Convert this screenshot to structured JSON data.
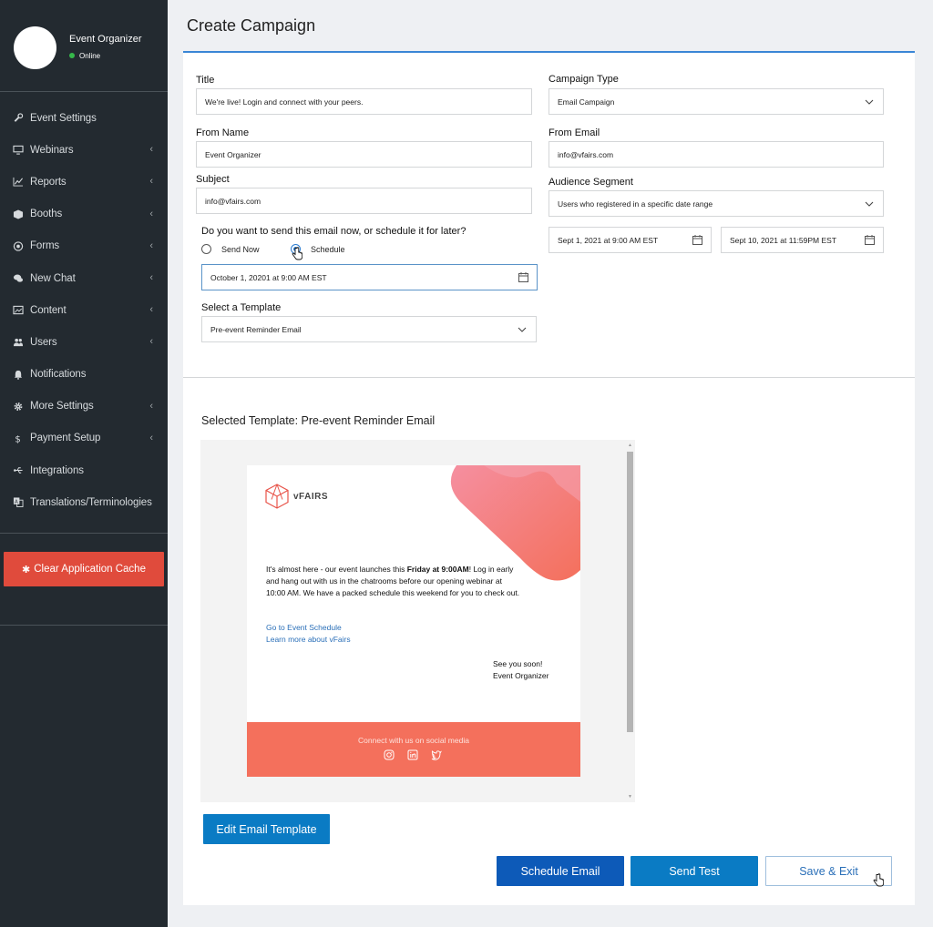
{
  "sidebar": {
    "profile": {
      "name": "Event Organizer",
      "status": "Online"
    },
    "items": [
      {
        "label": "Event Settings",
        "icon": "wrench-icon",
        "chevron": false
      },
      {
        "label": "Webinars",
        "icon": "monitor-icon",
        "chevron": true
      },
      {
        "label": "Reports",
        "icon": "chart-icon",
        "chevron": true
      },
      {
        "label": "Booths",
        "icon": "cube-icon",
        "chevron": true
      },
      {
        "label": "Forms",
        "icon": "target-icon",
        "chevron": true
      },
      {
        "label": "New Chat",
        "icon": "chat-icon",
        "chevron": true
      },
      {
        "label": "Content",
        "icon": "image-icon",
        "chevron": true
      },
      {
        "label": "Users",
        "icon": "users-icon",
        "chevron": true
      },
      {
        "label": "Notifications",
        "icon": "bell-icon",
        "chevron": false
      },
      {
        "label": "More Settings",
        "icon": "gear-icon",
        "chevron": true
      },
      {
        "label": "Payment Setup",
        "icon": "dollar-icon",
        "chevron": true
      },
      {
        "label": "Integrations",
        "icon": "plug-icon",
        "chevron": false
      },
      {
        "label": "Translations/Terminologies",
        "icon": "translate-icon",
        "chevron": false
      }
    ],
    "chevron_glyph": "‹",
    "clear_cache_label": "Clear Application Cache"
  },
  "page": {
    "title": "Create Campaign"
  },
  "form": {
    "title_label": "Title",
    "title_value": "We're live! Login and connect with your peers.",
    "campaign_type_label": "Campaign Type",
    "campaign_type_value": "Email Campaign",
    "from_name_label": "From Name",
    "from_name_value": "Event Organizer",
    "from_email_label": "From Email",
    "from_email_value": "info@vfairs.com",
    "subject_label": "Subject",
    "subject_value": "info@vfairs.com",
    "audience_label": "Audience Segment",
    "audience_value": "Users who registered in a specific date range",
    "date_start": "Sept 1, 2021 at 9:00 AM EST",
    "date_end": "Sept 10, 2021 at 11:59PM EST",
    "send_question": "Do you want to send this email now, or schedule it for later?",
    "send_now_label": "Send Now",
    "schedule_label": "Schedule",
    "selected_option": "Schedule",
    "schedule_datetime": "October 1, 20201 at 9:00 AM EST",
    "template_label": "Select a Template",
    "template_value": "Pre-event Reminder Email"
  },
  "preview": {
    "heading": "Selected Template: Pre-event Reminder Email",
    "logo_text": "vFAIRS",
    "body_before": "It's almost here - our event launches this ",
    "body_bold": "Friday at 9:00AM",
    "body_after": "! Log in early and hang out with us in the chatrooms before our opening webinar at 10:00 AM. We have a packed schedule this weekend for you to check out.",
    "link1": "Go to Event Schedule",
    "link2": "Learn more about vFairs",
    "signoff_line1": "See you soon!",
    "signoff_line2": "Event Organizer",
    "footer_text": "Connect with us on social media",
    "socials": [
      "instagram-icon",
      "linkedin-icon",
      "twitter-icon"
    ],
    "accent_color": "#f4705c"
  },
  "actions": {
    "edit_template": "Edit Email Template",
    "schedule_email": "Schedule Email",
    "send_test": "Send Test",
    "save_exit": "Save & Exit"
  },
  "colors": {
    "sidebar_bg": "#232a30",
    "primary": "#0a7bc4",
    "primary_dark": "#0d5ab8",
    "danger": "#e04b3c"
  }
}
